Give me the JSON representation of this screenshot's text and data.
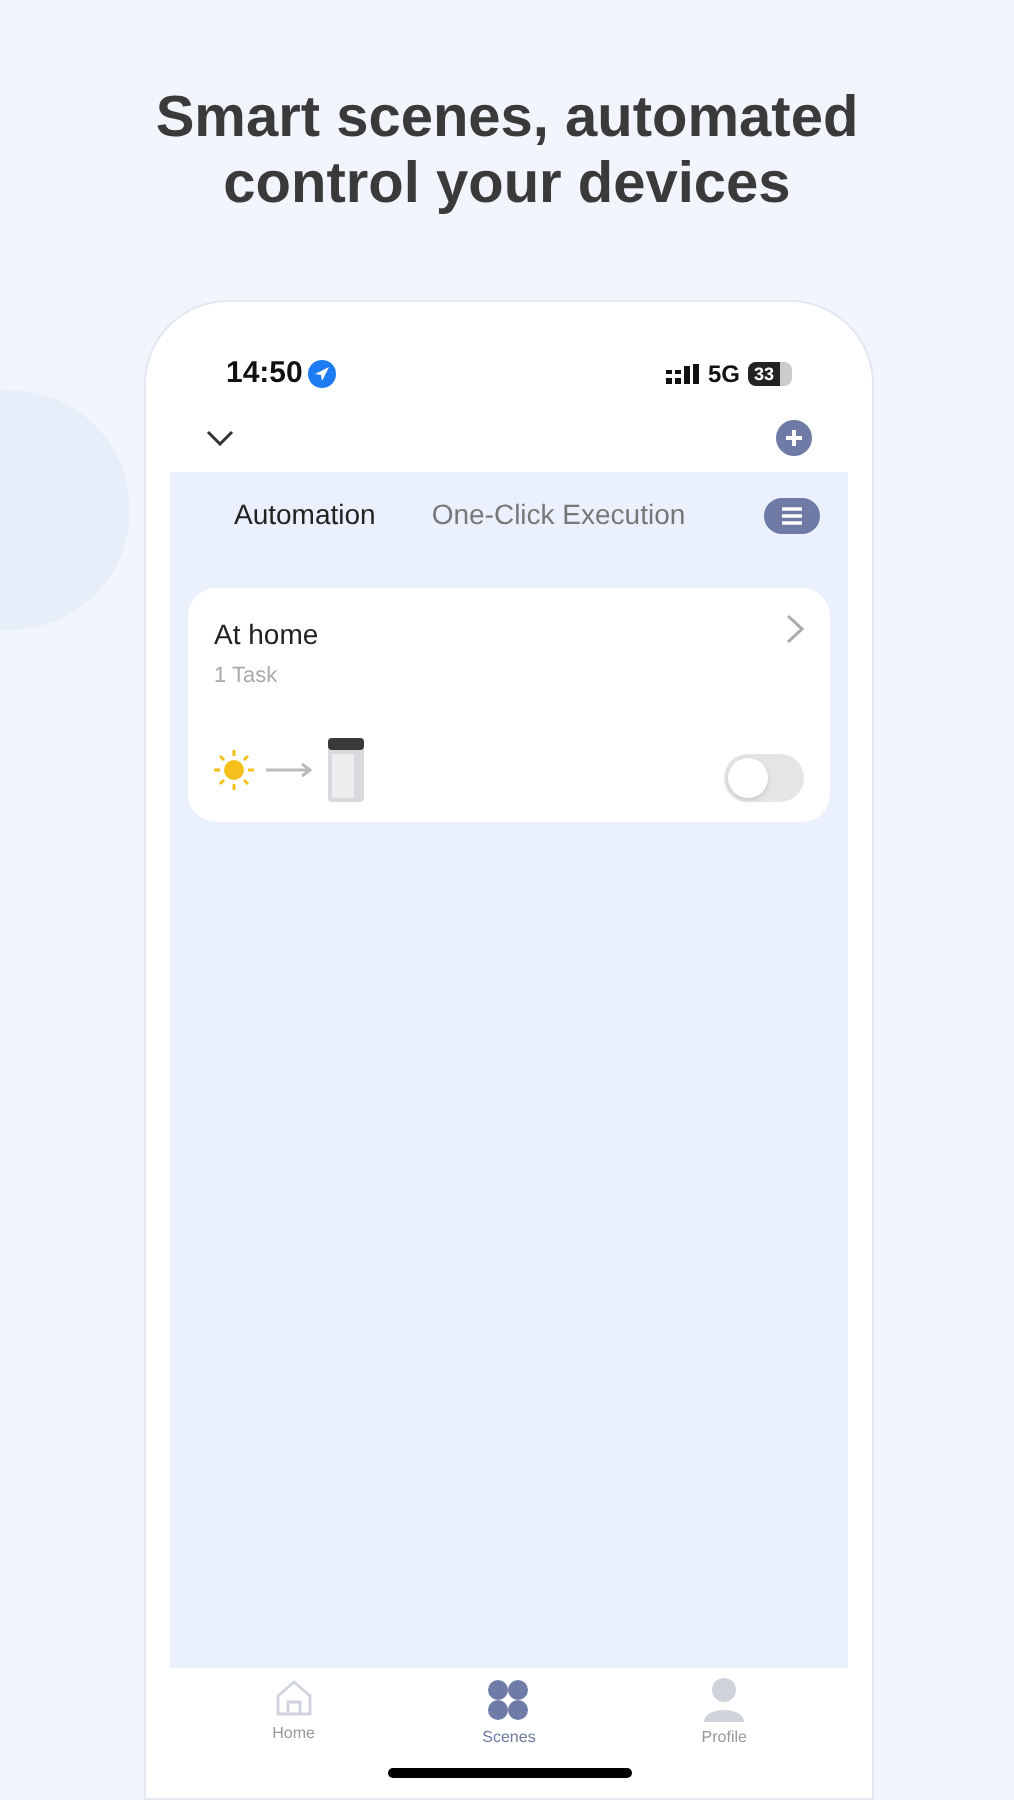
{
  "headline": [
    "Smart scenes, automated",
    "control your devices"
  ],
  "status_bar": {
    "time": "14:50",
    "network": "5G",
    "battery": "33"
  },
  "tabs": [
    {
      "label": "Automation",
      "selected": true
    },
    {
      "label": "One-Click Execution",
      "selected": false
    }
  ],
  "scenes": [
    {
      "title": "At home",
      "subtitle": "1 Task",
      "on": false
    }
  ],
  "nav": [
    {
      "label": "Home",
      "kind": "home",
      "selected": false
    },
    {
      "label": "Scenes",
      "kind": "scenes",
      "selected": true
    },
    {
      "label": "Profile",
      "kind": "profile",
      "selected": false
    }
  ]
}
